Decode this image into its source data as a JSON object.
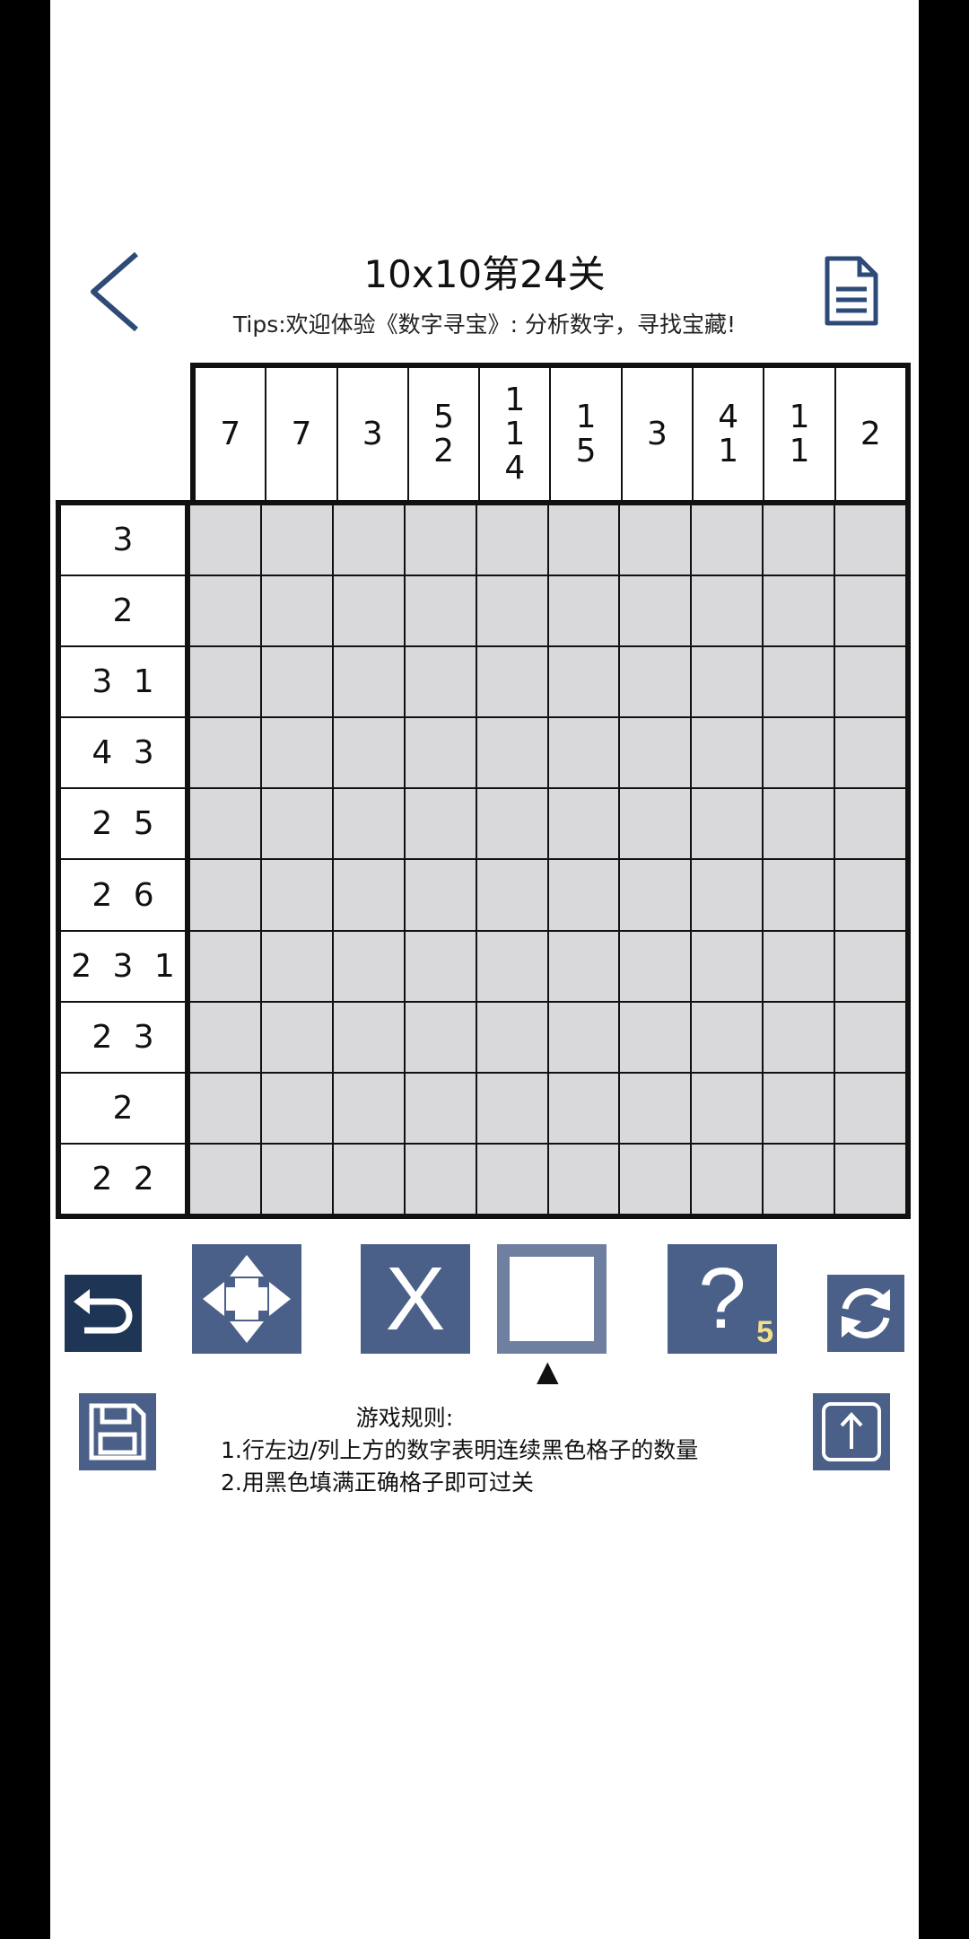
{
  "header": {
    "title": "10x10第24关",
    "tips": "Tips:欢迎体验《数字寻宝》: 分析数字，寻找宝藏!"
  },
  "puzzle": {
    "size": 10,
    "column_clues": [
      [
        "7"
      ],
      [
        "7"
      ],
      [
        "3"
      ],
      [
        "5",
        "2"
      ],
      [
        "1",
        "1",
        "4"
      ],
      [
        "1",
        "5"
      ],
      [
        "3"
      ],
      [
        "4",
        "1"
      ],
      [
        "1",
        "1"
      ],
      [
        "2"
      ]
    ],
    "row_clues": [
      "3",
      "2",
      "3 1",
      "4 3",
      "2 5",
      "2 6",
      "2 3 1",
      "2 3",
      "2",
      "2 2"
    ]
  },
  "toolbar": {
    "x_label": "X",
    "hint_label": "?",
    "hint_count": "5",
    "selected_indicator": "▲",
    "colors": {
      "tool_bg": "#4a6089",
      "undo_bg": "#1f3555",
      "fill_bg": "#6e7fa0",
      "hint_count": "#f2e08a",
      "cell_empty": "#d9d9db"
    }
  },
  "icons": {
    "back": "chevron-left-icon",
    "doc": "document-icon",
    "undo": "undo-icon",
    "move": "move-arrows-icon",
    "refresh": "refresh-icon",
    "save": "save-icon",
    "share": "share-icon"
  },
  "rules": {
    "title": "游戏规则:",
    "line1": "1.行左边/列上方的数字表明连续黑色格子的数量",
    "line2": "2.用黑色填满正确格子即可过关"
  }
}
